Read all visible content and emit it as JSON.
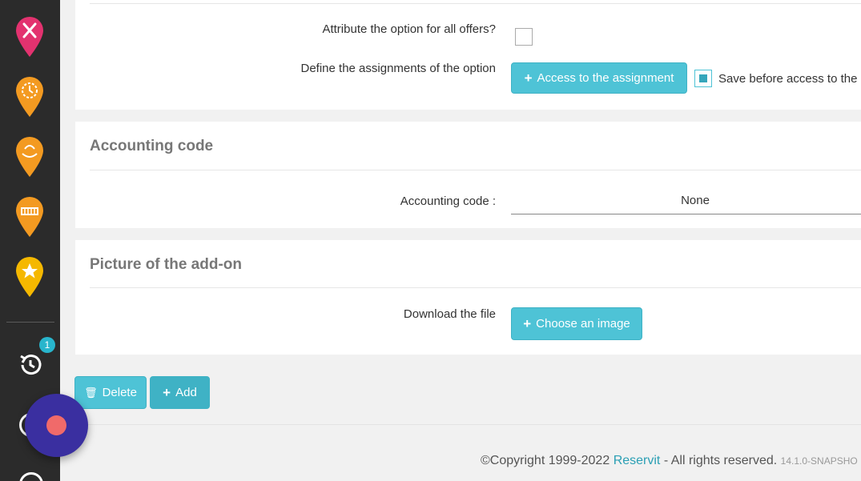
{
  "sidebar": {
    "icons": [
      {
        "name": "restaurant-pin-icon",
        "color": "#e3326f"
      },
      {
        "name": "clock-pin-icon",
        "color": "#f39a21"
      },
      {
        "name": "spa-pin-icon",
        "color": "#f39a21"
      },
      {
        "name": "group-pin-icon",
        "color": "#f39a21"
      },
      {
        "name": "star-pin-icon",
        "color": "#f5b800"
      }
    ],
    "history_badge": "1"
  },
  "options": {
    "attribute_label": "Attribute the option for all offers?",
    "assign_label": "Define the assignments of the option",
    "assign_button": "Access to the assignment",
    "save_label": "Save before access to the s"
  },
  "accounting": {
    "title": "Accounting code",
    "label": "Accounting code :",
    "value": "None"
  },
  "picture": {
    "title": "Picture of the add-on",
    "label": "Download the file",
    "button": "Choose an image"
  },
  "actions": {
    "delete": "Delete",
    "add": "Add"
  },
  "footer": {
    "copyright": "©Copyright 1999-2022",
    "brand": "Reservit",
    "rights": "- All rights reserved.",
    "version": "14.1.0-SNAPSHO"
  },
  "colors": {
    "accent": "#4ec3d6",
    "sidebar": "#2b2b2b",
    "record": "#3a2fa0"
  }
}
